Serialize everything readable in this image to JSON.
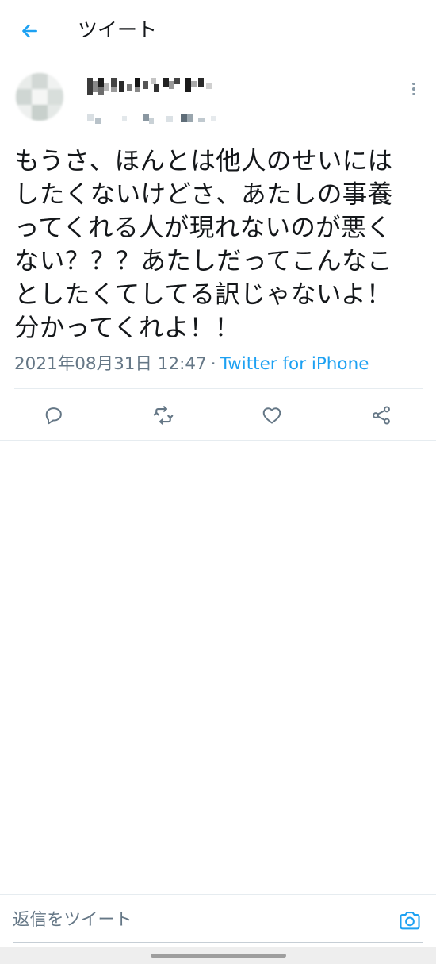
{
  "topbar": {
    "title": "ツイート",
    "back_icon": "arrow-left-icon"
  },
  "tweet": {
    "author": {
      "display_name": "",
      "handle": ""
    },
    "body_lines": [
      "もうさ、ほんとは他人のせいには",
      "したくないけどさ、あたしの事養",
      "ってくれる人が現れないのが悪く",
      "ない？？？あたしだってこんなこ",
      "としたくてしてる訳じゃないよ！",
      "分かってくれよ！！"
    ],
    "timestamp": "2021年08月31日 12:47",
    "separator": "·",
    "source": "Twitter for iPhone"
  },
  "actions": [
    {
      "name": "reply",
      "icon": "comment-icon"
    },
    {
      "name": "retweet",
      "icon": "retweet-icon"
    },
    {
      "name": "like",
      "icon": "heart-icon"
    },
    {
      "name": "share",
      "icon": "share-icon"
    }
  ],
  "reply_bar": {
    "placeholder": "返信をツイート",
    "camera_icon": "camera-icon"
  },
  "colors": {
    "accent": "#1da1f2",
    "text": "#14171a",
    "secondary": "#657786",
    "icon": "#657786",
    "divider": "#e6ecf0"
  }
}
